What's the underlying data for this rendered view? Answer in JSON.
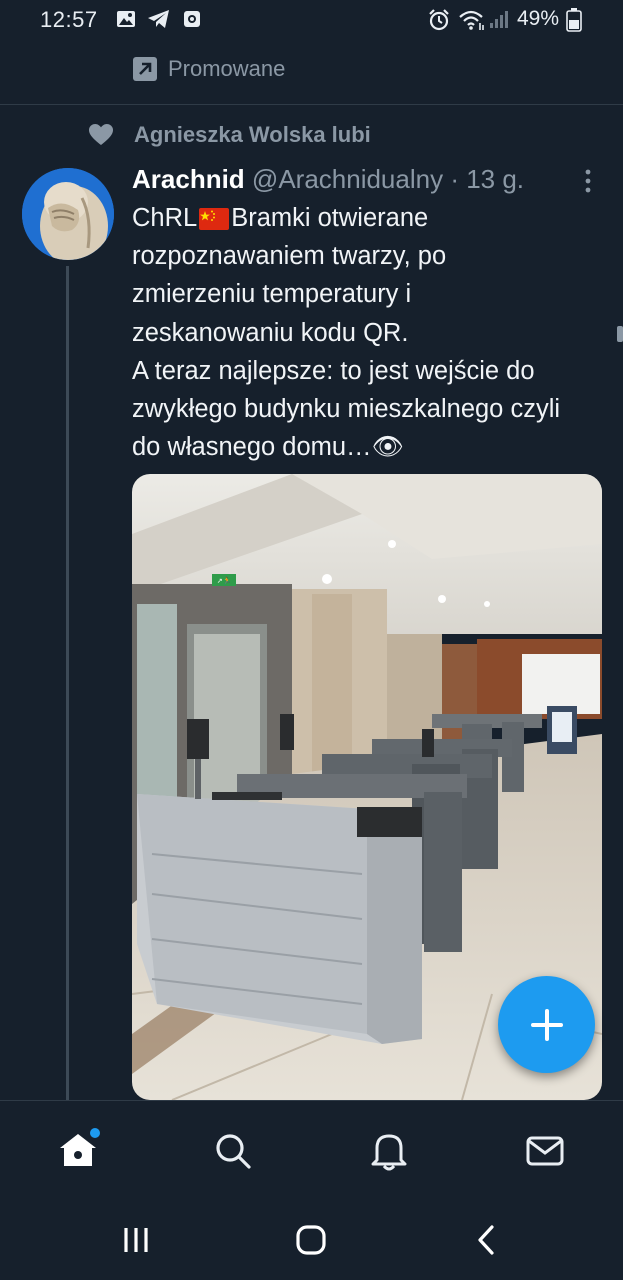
{
  "status_bar": {
    "time": "12:57",
    "battery": "49%"
  },
  "promoted": {
    "label": "Promowane"
  },
  "liked_by": {
    "text": "Agnieszka Wolska lubi"
  },
  "tweet": {
    "author_name": "Arachnid",
    "author_handle": "@Arachnidualny",
    "separator": " · ",
    "time_ago": "13 g.",
    "text": {
      "line1_pre": "ChRL",
      "line1_post": "Bramki otwierane",
      "line2": "rozpoznawaniem twarzy, po",
      "line3": "zmierzeniu temperatury i",
      "line4": "zeskanowaniu kodu QR.",
      "line5": "A teraz najlepsze: to jest wejście do",
      "line6": "zwykłego budynku mieszkalnego czyli",
      "line7": "do własnego domu…👁"
    },
    "media": {
      "exit_sign": "↗🏃"
    }
  },
  "colors": {
    "background": "#16202c",
    "accent": "#1d9bf0",
    "muted_text": "#8b98a5"
  },
  "icons": [
    "heart-icon",
    "promoted-arrow-icon",
    "more-vert-icon",
    "home-icon",
    "search-icon",
    "bell-icon",
    "mail-icon",
    "compose-plus-icon",
    "recents-icon",
    "home-pill-icon",
    "back-icon"
  ]
}
